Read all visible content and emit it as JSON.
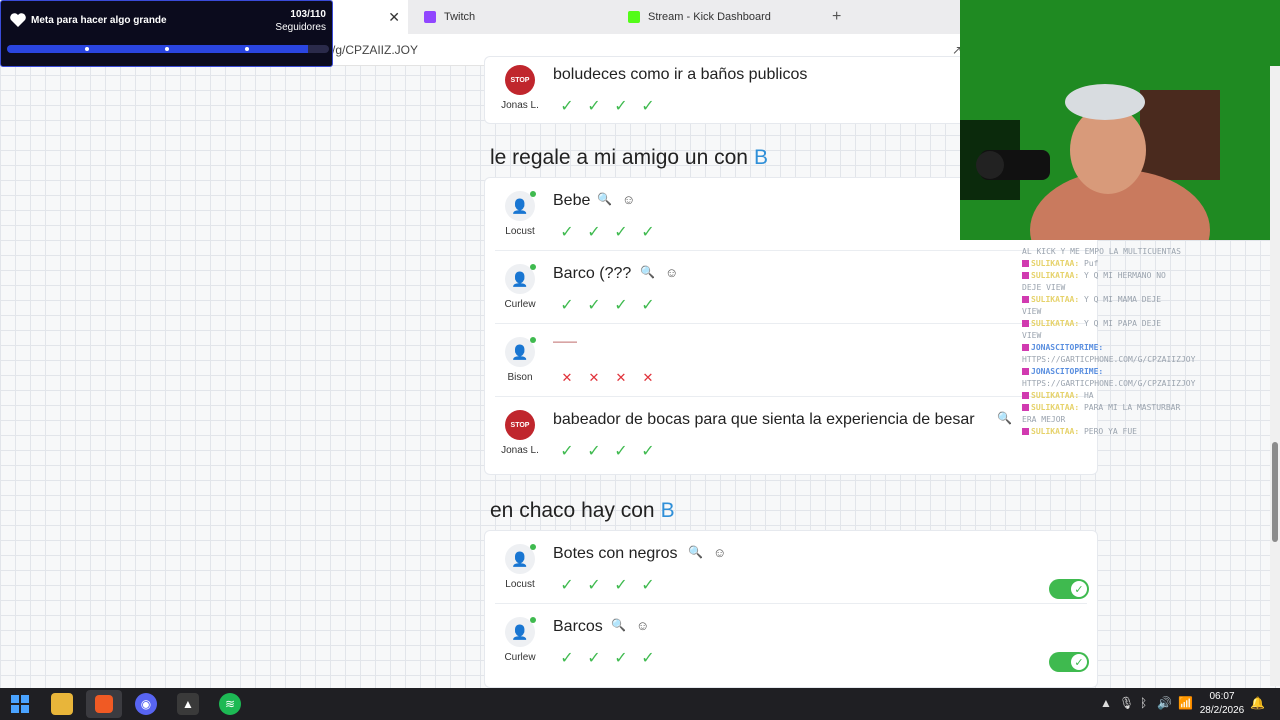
{
  "goal": {
    "title": "Meta para hacer algo grande",
    "count": "103/110",
    "subtitle": "Seguidores",
    "progress_fraction": 0.936
  },
  "tabs": [
    {
      "label": "Twitch",
      "color": "#9146ff"
    },
    {
      "label": "Stream - Kick Dashboard",
      "color": "#53fc18"
    }
  ],
  "url": "/g/CPZAIIZ.JOY",
  "sections": [
    {
      "heading": "",
      "letter": "",
      "rows": [
        {
          "user": "Jonas L.",
          "answer": "boludeces como ir a baños publicos",
          "checks": [
            "ok",
            "ok",
            "ok",
            "ok"
          ],
          "avatar": "stop"
        }
      ]
    },
    {
      "heading": "le regale a mi amigo un con",
      "letter": "B",
      "rows": [
        {
          "user": "Locust",
          "answer": "Bebe",
          "checks": [
            "ok",
            "ok",
            "ok",
            "ok"
          ],
          "avatar": "person"
        },
        {
          "user": "Curlew",
          "answer": "Barco (???",
          "checks": [
            "ok",
            "ok",
            "ok",
            "ok"
          ],
          "avatar": "person"
        },
        {
          "user": "Bison",
          "answer": "——",
          "checks": [
            "no",
            "no",
            "no",
            "no"
          ],
          "avatar": "person"
        },
        {
          "user": "Jonas L.",
          "answer": "babeador de bocas para que sienta la experiencia de besar",
          "checks": [
            "ok",
            "ok",
            "ok",
            "ok"
          ],
          "avatar": "stop"
        }
      ]
    },
    {
      "heading": "en chaco hay con",
      "letter": "B",
      "rows": [
        {
          "user": "Locust",
          "answer": "Botes con negros",
          "checks": [
            "ok",
            "ok",
            "ok",
            "ok"
          ],
          "avatar": "person"
        },
        {
          "user": "Curlew",
          "answer": "Barcos",
          "checks": [
            "ok",
            "ok",
            "ok",
            "ok"
          ],
          "avatar": "person"
        }
      ]
    }
  ],
  "chat": [
    {
      "name": "",
      "text": "AL KICK Y ME EMPO LA MULTICUENTAS"
    },
    {
      "name": "SULIKATAA:",
      "text": "Puf"
    },
    {
      "name": "SULIKATAA:",
      "text": "Y Q MI HERMANO NO DEJE VIEW"
    },
    {
      "name": "SULIKATAA:",
      "text": "Y Q MI MAMA DEJE VIEW"
    },
    {
      "name": "SULIKATAA:",
      "text": "Y Q MI PAPA DEJE VIEW"
    },
    {
      "name": "JONASCITOPRIME:",
      "text": "HTTPS://GARTICPHONE.COM/G/CPZAIIZJOY",
      "blue": true
    },
    {
      "name": "JONASCITOPRIME:",
      "text": "HTTPS://GARTICPHONE.COM/G/CPZAIIZJOY",
      "blue": true
    },
    {
      "name": "SULIKATAA:",
      "text": "HA"
    },
    {
      "name": "SULIKATAA:",
      "text": "PARA MI LA MASTURBAR ERA MEJOR"
    },
    {
      "name": "SULIKATAA:",
      "text": "PERO YA FUE"
    }
  ],
  "clock": {
    "time": "06:07",
    "date": "28/2/2026"
  },
  "colors": {
    "check": "#3fba4f",
    "cross": "#e0323a",
    "letter": "#2f8fd8",
    "goal_fill": "#2a45e0"
  }
}
